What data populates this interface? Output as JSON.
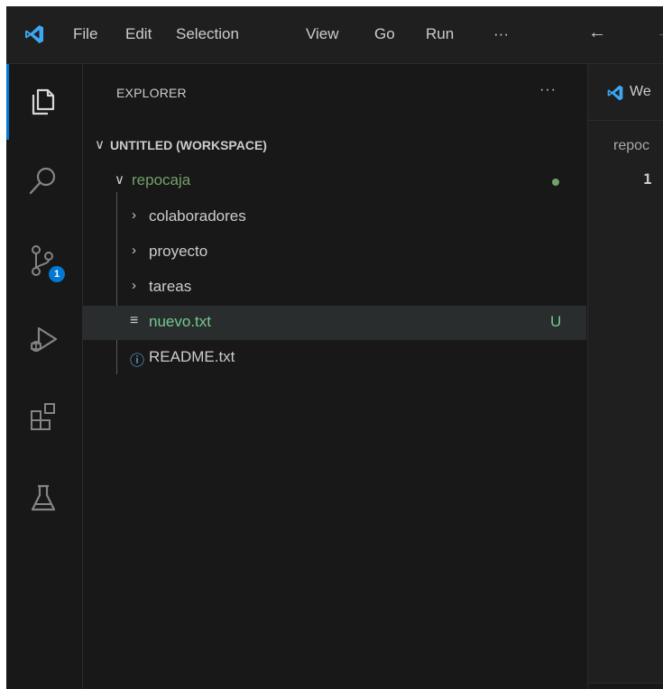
{
  "menu": [
    "File",
    "Edit",
    "Selection",
    "View",
    "Go",
    "Run",
    "···"
  ],
  "icons": {
    "logo": "vscode-logo-icon",
    "explorer": "files-icon",
    "search": "search-icon",
    "source_control": "source-control-icon",
    "run_debug": "run-debug-icon",
    "extensions": "extensions-icon",
    "testing": "testing-flask-icon"
  },
  "source_control_badge": "1",
  "explorer": {
    "title": "EXPLORER",
    "more": "···",
    "workspace": "UNTITLED (WORKSPACE)",
    "tree": [
      {
        "label": "repocaja",
        "type": "folder",
        "expanded": true,
        "status": "dot"
      },
      {
        "label": "colaboradores",
        "type": "folder",
        "expanded": false
      },
      {
        "label": "proyecto",
        "type": "folder",
        "expanded": false
      },
      {
        "label": "tareas",
        "type": "folder",
        "expanded": false
      },
      {
        "label": "nuevo.txt",
        "type": "file",
        "status": "U",
        "selected": true
      },
      {
        "label": "README.txt",
        "type": "file"
      }
    ]
  },
  "editor": {
    "tab_label": "We",
    "breadcrumb": "repoc",
    "line_number": "1"
  },
  "colors": {
    "accent": "#0078d4",
    "git_green": "#73c991",
    "folder_modified": "#73a069",
    "background": "#181818"
  }
}
